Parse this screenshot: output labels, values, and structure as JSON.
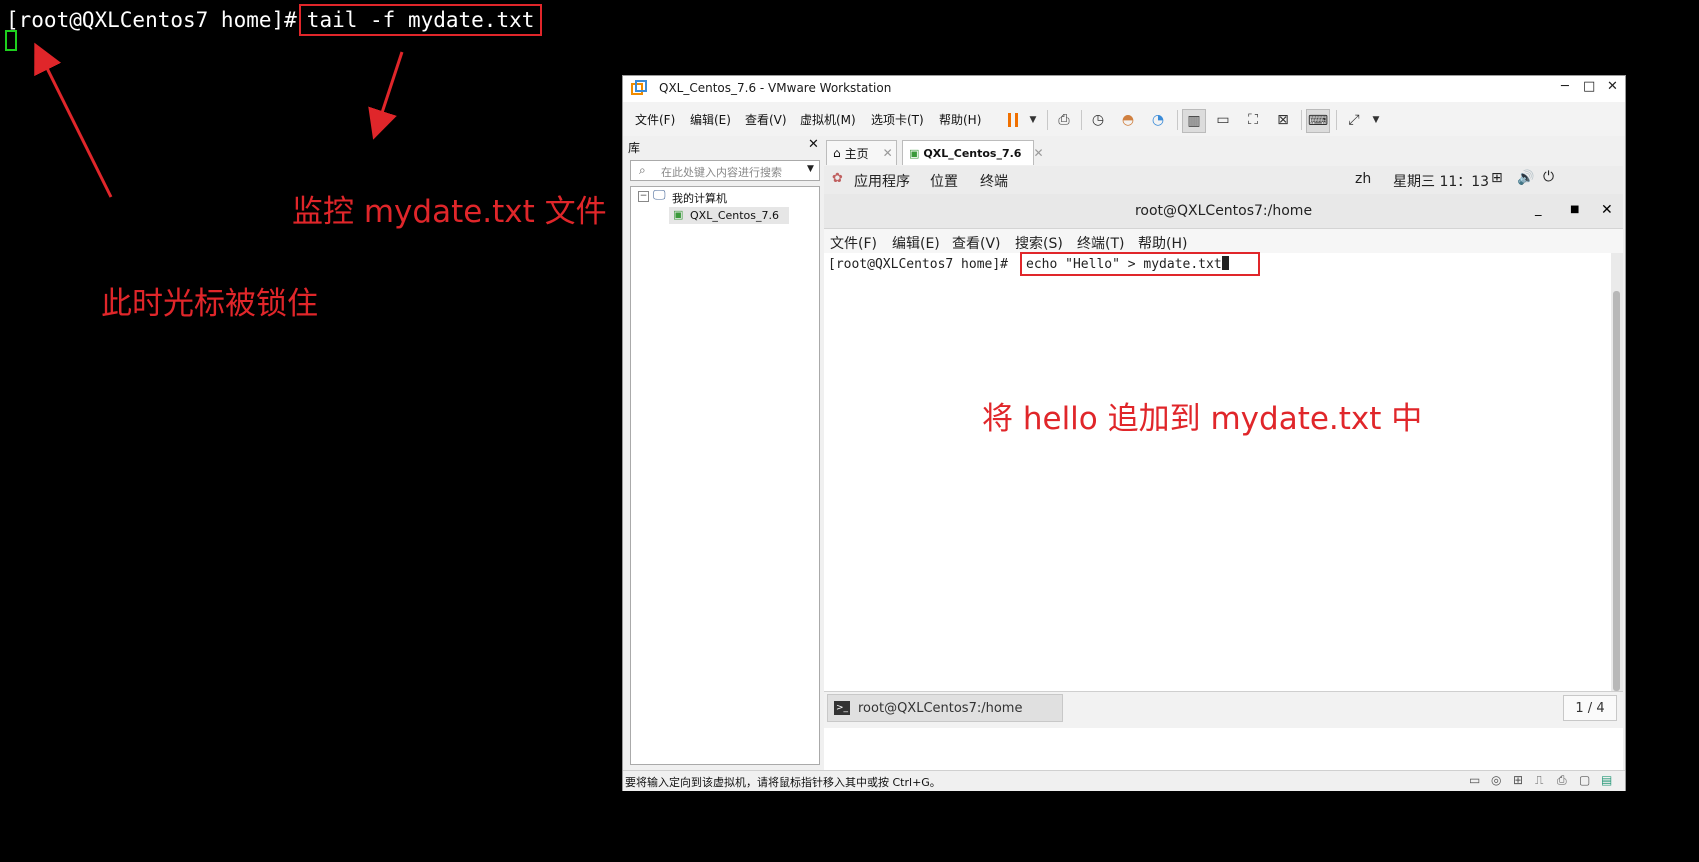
{
  "terminal": {
    "prompt": "[root@QXLCentos7 home]#",
    "command": "tail -f mydate.txt"
  },
  "annotations": {
    "monitor": "监控 mydate.txt 文件",
    "cursor_locked": "此时光标被锁住",
    "append": "将 hello 追加到 mydate.txt 中"
  },
  "colors": {
    "annotation": "#e0262a",
    "cursor": "#1ed01e"
  },
  "vmware": {
    "title": "QXL_Centos_7.6 - VMware Workstation",
    "window_controls": [
      "─",
      "□",
      "✕"
    ],
    "menu": [
      "文件(F)",
      "编辑(E)",
      "查看(V)",
      "虚拟机(M)",
      "选项卡(T)",
      "帮助(H)"
    ],
    "library": {
      "title": "库",
      "search_placeholder": "在此处键入内容进行搜索",
      "tree_root": "我的计算机",
      "tree_child": "QXL_Centos_7.6"
    },
    "tabs": [
      "主页",
      "QXL_Centos_7.6"
    ],
    "status_bar": "要将输入定向到该虚拟机，请将鼠标指针移入其中或按 Ctrl+G。"
  },
  "gnome": {
    "applications": "应用程序",
    "places": "位置",
    "terminal": "终端",
    "lang": "zh",
    "clock": "星期三 11：13"
  },
  "guest_terminal": {
    "title": "root@QXLCentos7:/home",
    "menu": [
      "文件(F)",
      "编辑(E)",
      "查看(V)",
      "搜索(S)",
      "终端(T)",
      "帮助(H)"
    ],
    "prompt": "[root@QXLCentos7 home]#",
    "command": "echo \"Hello\" > mydate.txt",
    "taskbar_item": "root@QXLCentos7:/home",
    "pager": "1 / 4"
  }
}
